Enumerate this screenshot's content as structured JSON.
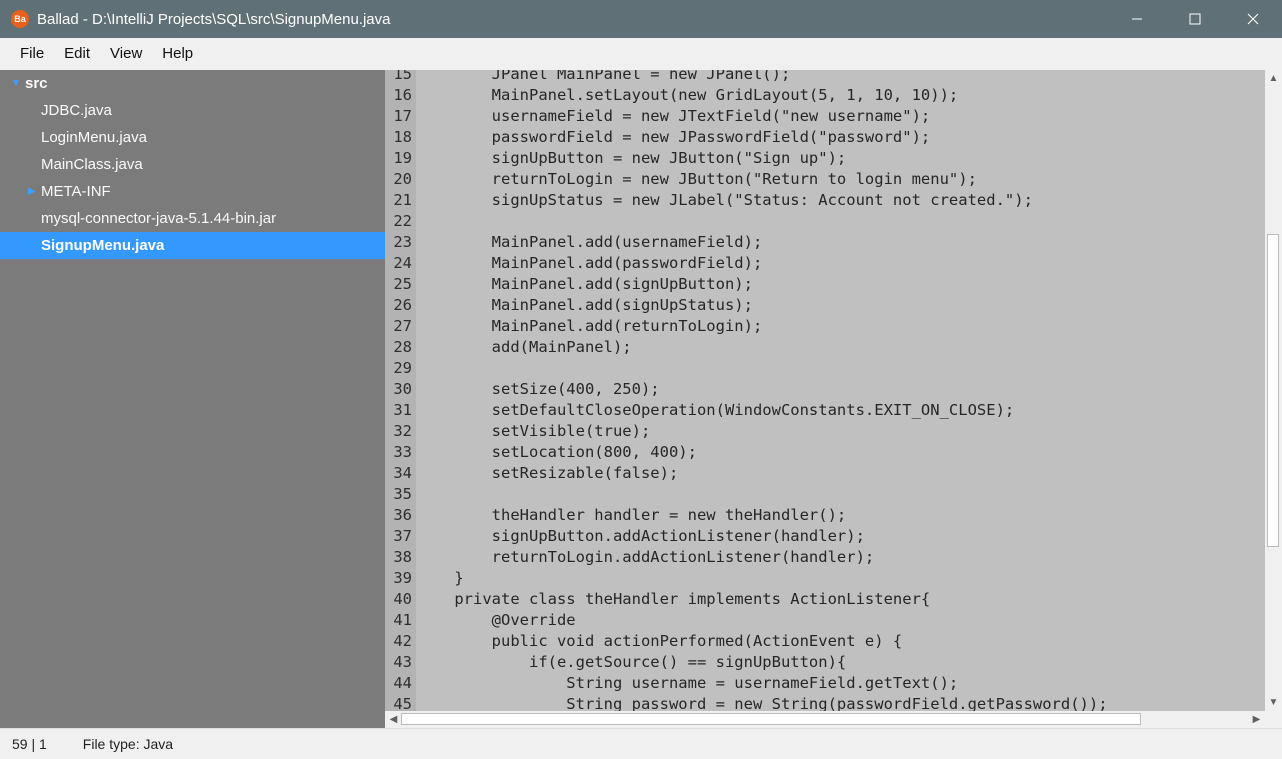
{
  "window": {
    "icon_text": "Ba",
    "title": "Ballad - D:\\IntelliJ Projects\\SQL\\src\\SignupMenu.java"
  },
  "menu": [
    "File",
    "Edit",
    "View",
    "Help"
  ],
  "tree": {
    "root": "src",
    "items": [
      "JDBC.java",
      "LoginMenu.java",
      "MainClass.java",
      "META-INF",
      "mysql-connector-java-5.1.44-bin.jar",
      "SignupMenu.java"
    ],
    "selected": "SignupMenu.java"
  },
  "code": {
    "lines": [
      {
        "n": "15",
        "t": "        JPanel MainPanel = new JPanel();"
      },
      {
        "n": "16",
        "t": "        MainPanel.setLayout(new GridLayout(5, 1, 10, 10));"
      },
      {
        "n": "17",
        "t": "        usernameField = new JTextField(\"new username\");"
      },
      {
        "n": "18",
        "t": "        passwordField = new JPasswordField(\"password\");"
      },
      {
        "n": "19",
        "t": "        signUpButton = new JButton(\"Sign up\");"
      },
      {
        "n": "20",
        "t": "        returnToLogin = new JButton(\"Return to login menu\");"
      },
      {
        "n": "21",
        "t": "        signUpStatus = new JLabel(\"Status: Account not created.\");"
      },
      {
        "n": "22",
        "t": ""
      },
      {
        "n": "23",
        "t": "        MainPanel.add(usernameField);"
      },
      {
        "n": "24",
        "t": "        MainPanel.add(passwordField);"
      },
      {
        "n": "25",
        "t": "        MainPanel.add(signUpButton);"
      },
      {
        "n": "26",
        "t": "        MainPanel.add(signUpStatus);"
      },
      {
        "n": "27",
        "t": "        MainPanel.add(returnToLogin);"
      },
      {
        "n": "28",
        "t": "        add(MainPanel);"
      },
      {
        "n": "29",
        "t": ""
      },
      {
        "n": "30",
        "t": "        setSize(400, 250);"
      },
      {
        "n": "31",
        "t": "        setDefaultCloseOperation(WindowConstants.EXIT_ON_CLOSE);"
      },
      {
        "n": "32",
        "t": "        setVisible(true);"
      },
      {
        "n": "33",
        "t": "        setLocation(800, 400);"
      },
      {
        "n": "34",
        "t": "        setResizable(false);"
      },
      {
        "n": "35",
        "t": ""
      },
      {
        "n": "36",
        "t": "        theHandler handler = new theHandler();"
      },
      {
        "n": "37",
        "t": "        signUpButton.addActionListener(handler);"
      },
      {
        "n": "38",
        "t": "        returnToLogin.addActionListener(handler);"
      },
      {
        "n": "39",
        "t": "    }"
      },
      {
        "n": "40",
        "t": "    private class theHandler implements ActionListener{"
      },
      {
        "n": "41",
        "t": "        @Override"
      },
      {
        "n": "42",
        "t": "        public void actionPerformed(ActionEvent e) {"
      },
      {
        "n": "43",
        "t": "            if(e.getSource() == signUpButton){"
      },
      {
        "n": "44",
        "t": "                String username = usernameField.getText();"
      },
      {
        "n": "45",
        "t": "                String password = new String(passwordField.getPassword());"
      }
    ]
  },
  "status": {
    "position": "59 | 1",
    "file_type": "File type: Java"
  },
  "colors": {
    "titlebar": "#5f7076",
    "sidebar": "#7b7b7b",
    "selection": "#3399ff",
    "editor": "#c0c0c0",
    "gutter": "#b3b3b3",
    "app_icon": "#e8601c"
  }
}
